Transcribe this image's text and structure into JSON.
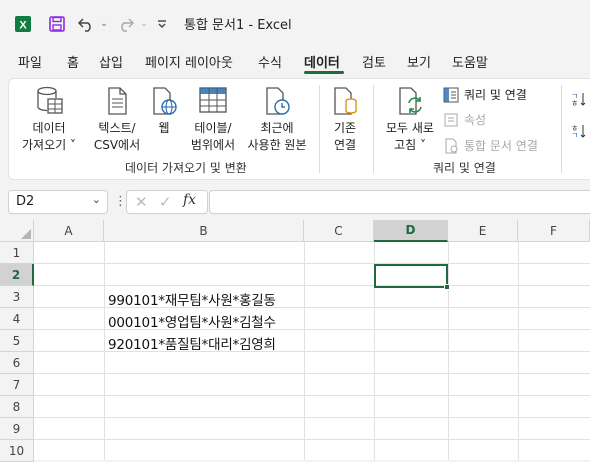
{
  "titlebar": {
    "qat_more_label": "⌄",
    "title": "통합 문서1  -  Excel"
  },
  "menu": {
    "tabs": [
      {
        "label": "파일"
      },
      {
        "label": "홈"
      },
      {
        "label": "삽입"
      },
      {
        "label": "페이지 레이아웃"
      },
      {
        "label": "수식"
      },
      {
        "label": "데이터",
        "active": true
      },
      {
        "label": "검토"
      },
      {
        "label": "보기"
      },
      {
        "label": "도움말"
      }
    ]
  },
  "ribbon": {
    "get_data": {
      "line1": "데이터",
      "line2": "가져오기 ˅"
    },
    "text_csv": {
      "line1": "텍스트/",
      "line2": "CSV에서"
    },
    "web": {
      "line1": "웹"
    },
    "table_range": {
      "line1": "테이블/",
      "line2": "범위에서"
    },
    "recent_sources": {
      "line1": "최근에",
      "line2": "사용한 원본"
    },
    "existing_conn": {
      "line1": "기존",
      "line2": "연결"
    },
    "group1_label": "데이터 가져오기 및 변환",
    "refresh_all": {
      "line1": "모두 새로",
      "line2": "고침 ˅"
    },
    "queries_conn": "쿼리 및 연결",
    "properties": "속성",
    "edit_links": "통합 문서 연결",
    "group2_label": "쿼리 및 연결"
  },
  "formula_bar": {
    "name_box": "D2",
    "formula_value": ""
  },
  "sheet": {
    "columns": [
      "A",
      "B",
      "C",
      "D",
      "E",
      "F"
    ],
    "rows": [
      "1",
      "2",
      "3",
      "4",
      "5",
      "6",
      "7",
      "8",
      "9",
      "10"
    ],
    "selected_column": "D",
    "selected_row": "2",
    "cells": {
      "B3": "990101*재무팀*사원*홍길동",
      "B4": "000101*영업팀*사원*김철수",
      "B5": "920101*품질팀*대리*김영희"
    }
  },
  "colors": {
    "accent": "#1e6b3f",
    "excel_green": "#107c41"
  }
}
